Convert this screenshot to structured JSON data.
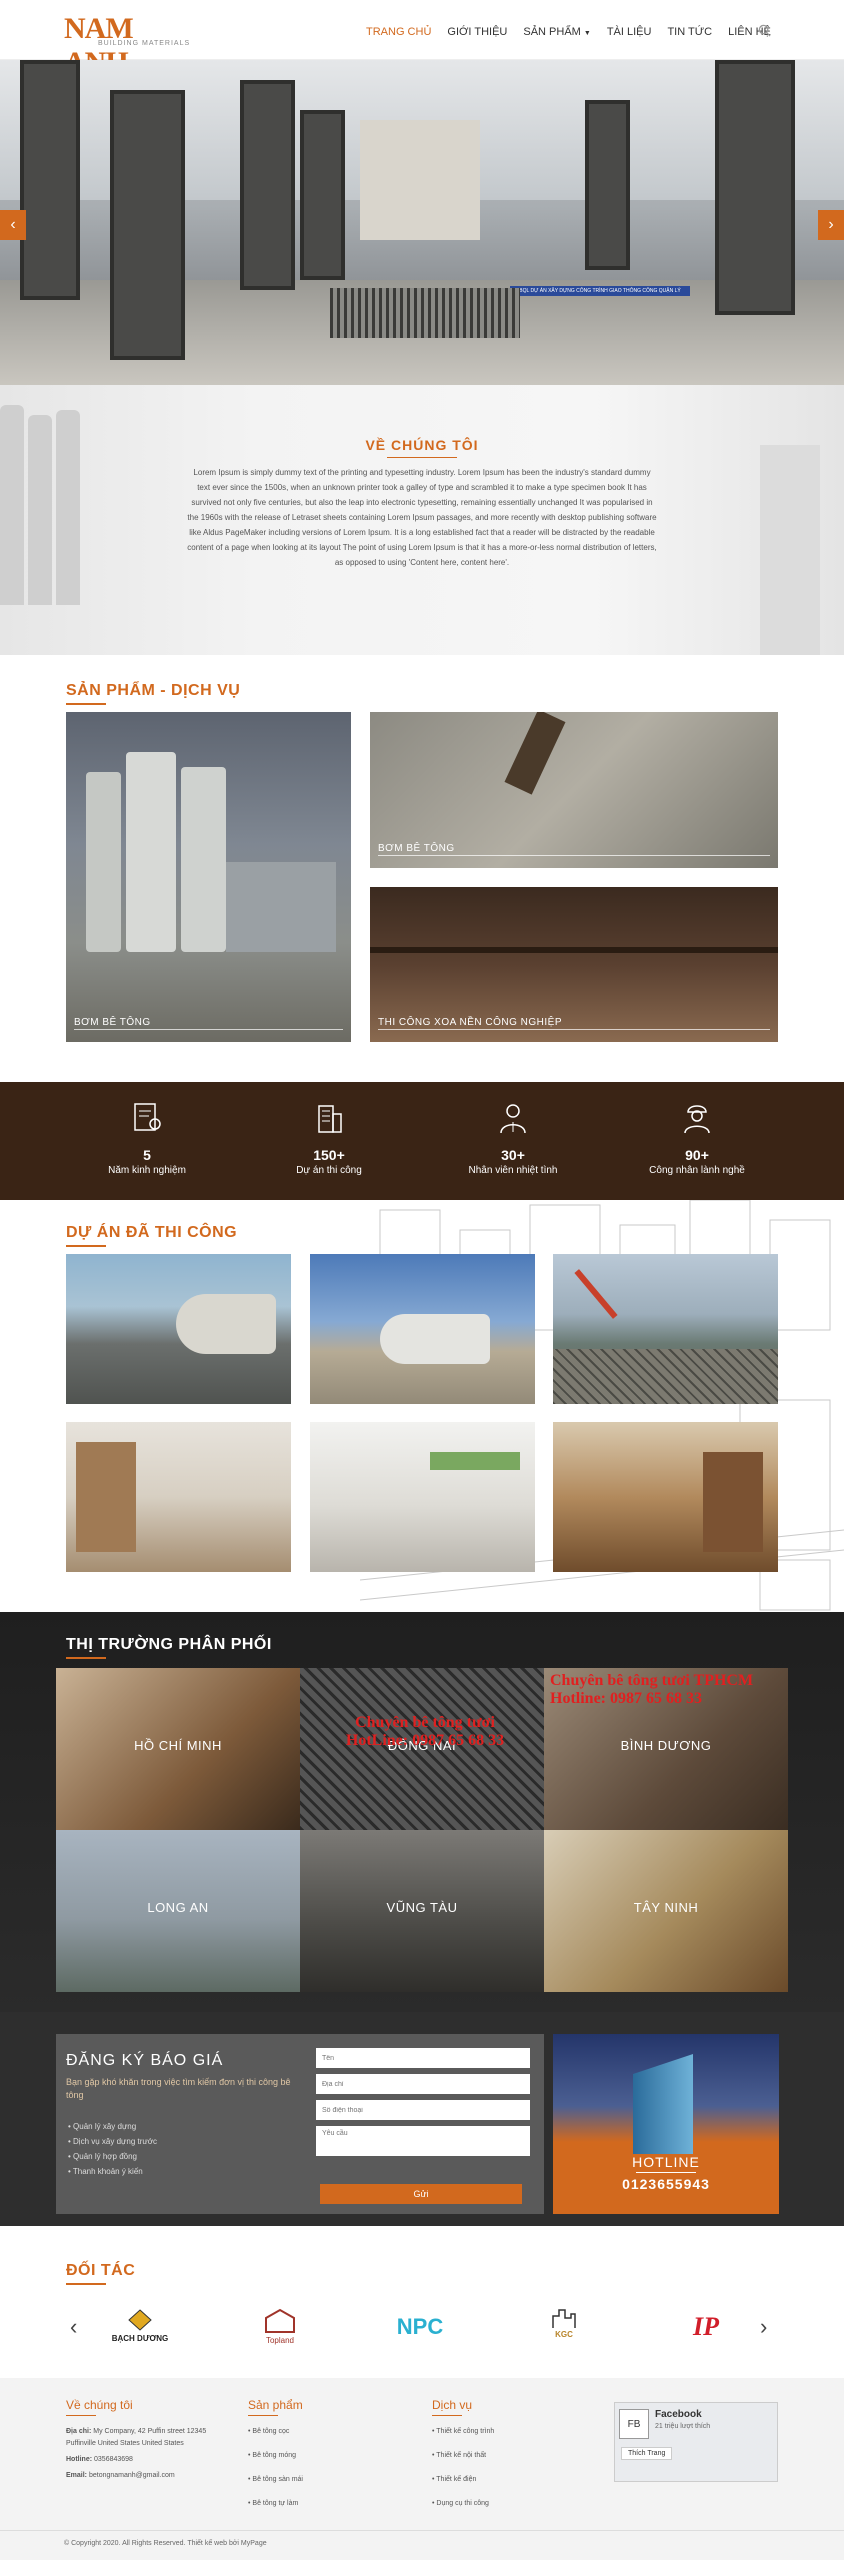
{
  "header": {
    "logo_text": "NAM ANH",
    "logo_sub": "BUILDING MATERIALS",
    "nav": [
      "TRANG CHỦ",
      "GIỚI THIỆU",
      "SẢN PHẨM",
      "TÀI LIỆU",
      "TIN TỨC",
      "LIÊN HỆ"
    ],
    "search_icon": "search-icon",
    "dropdown_icon": "caret-down-icon"
  },
  "hero": {
    "prev": "‹",
    "next": "›",
    "banner_text": "BQL DỰ ÁN XÂY DỰNG CÔNG TRÌNH GIAO THÔNG CÔNG QUẬN LÝ"
  },
  "about": {
    "title": "VỀ CHÚNG TÔI",
    "text": "Lorem Ipsum is simply dummy text of the printing and typesetting industry. Lorem Ipsum has been the industry's standard dummy text ever since the 1500s, when an unknown printer took a galley of type and scrambled it to make a type specimen book It has survived not only five centuries, but also the leap into electronic typesetting, remaining essentially unchanged It was popularised in the 1960s with the release of Letraset sheets containing Lorem Ipsum passages, and more recently with desktop publishing software like Aldus PageMaker including versions of Lorem Ipsum. It is a long established fact that a reader will be distracted by the readable content of a page when looking at its layout The point of using Lorem Ipsum is that it has a more-or-less normal distribution of letters, as opposed to using 'Content here, content here'."
  },
  "products": {
    "title": "SẢN PHẨM - DỊCH VỤ",
    "items": [
      "BƠM BÊ TÔNG",
      "BƠM BÊ TÔNG",
      "THI CÔNG XOA NỀN CÔNG NGHIỆP"
    ]
  },
  "stats": [
    {
      "num": "5",
      "label": "Năm kinh nghiệm",
      "icon": "certificate-icon"
    },
    {
      "num": "150+",
      "label": "Dự án thi công",
      "icon": "building-icon"
    },
    {
      "num": "30+",
      "label": "Nhân viên nhiệt tình",
      "icon": "employee-icon"
    },
    {
      "num": "90+",
      "label": "Công nhân lành nghề",
      "icon": "worker-icon"
    }
  ],
  "projects": {
    "title": "DỰ ÁN ĐÃ THI CÔNG"
  },
  "market": {
    "title": "THỊ TRƯỜNG PHÂN PHỐI",
    "cities": [
      "HỒ CHÍ MINH",
      "ĐỒNG NAI",
      "BÌNH DƯƠNG",
      "LONG AN",
      "VŨNG TÀU",
      "TÂY NINH"
    ],
    "watermark1": "Chuyên bê tông tươi",
    "watermark2": "HotLine: 0987 65 68 33",
    "watermark3": "Chuyên bê tông tươi TPHCM",
    "watermark4": "Hotline: 0987 65 68 33"
  },
  "register": {
    "title": "ĐĂNG KÝ BÁO GIÁ",
    "intro": "Bạn gặp khó khăn trong việc tìm kiếm đơn vị thi công bê tông",
    "bullets": [
      "Quản lý xây dựng",
      "Dịch vụ xây dựng trước",
      "Quản lý hợp đồng",
      "Thanh khoản ý kiến"
    ],
    "placeholders": [
      "Tên",
      "Địa chỉ",
      "Số điện thoại",
      "Yêu cầu"
    ],
    "button": "Gửi",
    "hotline_label": "HOTLINE",
    "hotline_number": "0123655943"
  },
  "partners": {
    "title": "ĐỐI TÁC",
    "logos": [
      "BẠCH DƯƠNG",
      "Topland",
      "NPC",
      "KGC",
      "IP"
    ]
  },
  "footer": {
    "about": {
      "title": "Về chúng tôi",
      "address_label": "Địa chỉ:",
      "address": "My Company, 42 Puffin street 12345 Puffinville United States United States",
      "hotline_label": "Hotline:",
      "hotline": "0356843698",
      "email_label": "Email:",
      "email": "betongnamanh@gmail.com"
    },
    "products": {
      "title": "Sản phẩm",
      "items": [
        "Bê tông cọc",
        "Bê tông móng",
        "Bê tông sàn mái",
        "Bê tông tự làm"
      ]
    },
    "services": {
      "title": "Dịch vụ",
      "items": [
        "Thiết kế công trình",
        "Thiết kế nội thất",
        "Thiết kế điện",
        "Dụng cụ thi công"
      ]
    },
    "fb": {
      "name": "Facebook",
      "likes": "21 triệu lượt thích",
      "like_btn": "Thích Trang"
    },
    "copyright": "© Copyright 2020. All Rights Reserved. Thiết kế web bởi MyPage"
  },
  "colors": {
    "accent": "#d2691e",
    "dark": "#3a2415"
  }
}
